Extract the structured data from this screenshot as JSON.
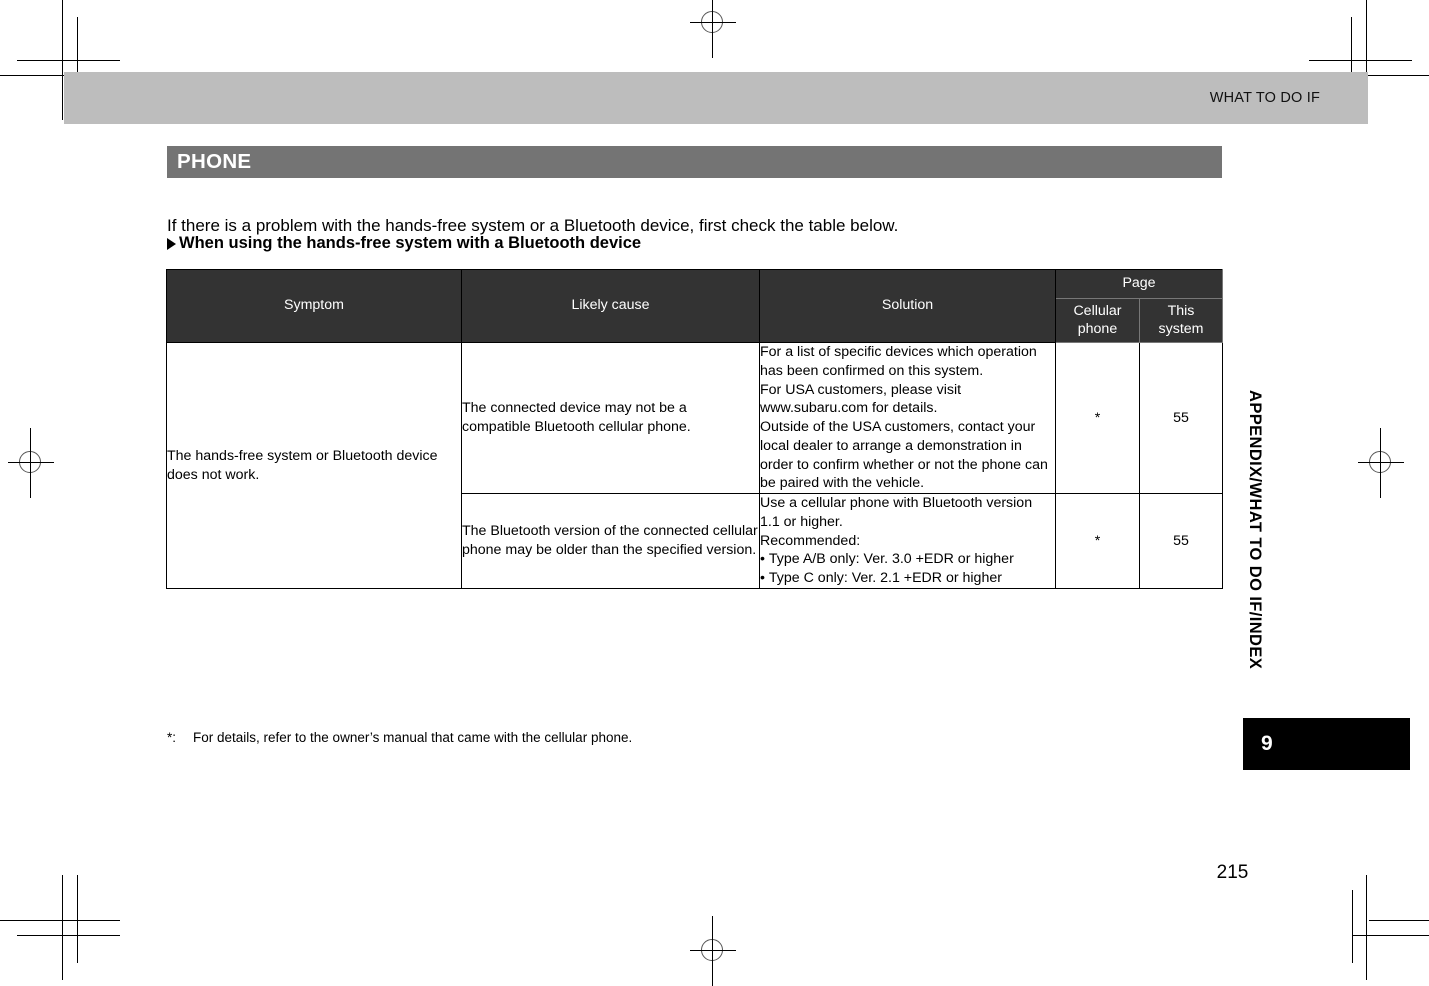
{
  "page": {
    "running_head": "WHAT TO DO IF",
    "folio": "215",
    "side_tab_text": "APPENDIX/WHAT TO DO IF/INDEX",
    "chapter_number": "9"
  },
  "section": {
    "bar_title": "PHONE",
    "intro": "If there is a problem with the hands-free system or a Bluetooth device, first check the table below.",
    "subheading": "When using the hands-free system with a Bluetooth device"
  },
  "table": {
    "headers": {
      "symptom": "Symptom",
      "likely_cause": "Likely cause",
      "solution": "Solution",
      "page_group": "Page",
      "page_cellular": "Cellular phone",
      "page_cellular_l1": "Cellular",
      "page_cellular_l2": "phone",
      "page_this_system": "This system",
      "page_this_l1": "This",
      "page_this_l2": "system"
    },
    "rows": [
      {
        "symptom": "The hands-free system or Bluetooth device does not work.",
        "cause": "The connected device may not be a compatible Bluetooth cellular phone.",
        "solution_lines": [
          "For a list of specific devices which operation has been confirmed on this system.",
          "For USA customers, please visit www.subaru.com for details.",
          "Outside of the USA customers, contact your local dealer to arrange a demonstration in order to confirm whether or not the phone can be paired with the vehicle."
        ],
        "page_cellular": "*",
        "page_this_system": "55"
      },
      {
        "cause": "The Bluetooth version of the connected cellular phone may be older than the specified version.",
        "solution_lines": [
          "Use a cellular phone with Bluetooth version 1.1 or higher.",
          "Recommended:"
        ],
        "solution_bullets": [
          "Type A/B only: Ver. 3.0 +EDR or higher",
          "Type C only: Ver. 2.1 +EDR or higher"
        ],
        "page_cellular": "*",
        "page_this_system": "55"
      }
    ]
  },
  "footnote": {
    "marker": "*:",
    "text": "For details, refer to the owner’s manual that came with the cellular phone."
  },
  "colors": {
    "header_band": "#bdbdbd",
    "section_bar": "#747474",
    "table_header": "#333333",
    "tab_box": "#000000"
  }
}
